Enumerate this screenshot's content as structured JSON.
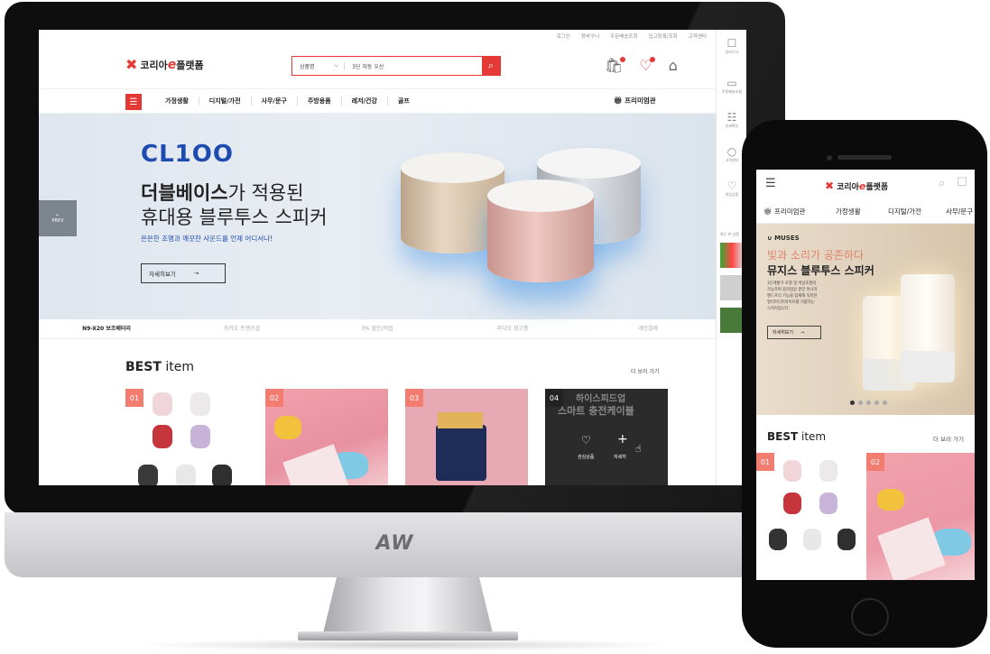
{
  "desktop": {
    "util_links": [
      "로그인",
      "장바구니",
      "주문배송조회",
      "입고등록/조회",
      "고객센터"
    ],
    "logo": {
      "prefix": "코리아",
      "mark": "e",
      "suffix": "플랫폼"
    },
    "search": {
      "category": "상품명",
      "query": "3단 자동 우산"
    },
    "nav_items": [
      "가정생활",
      "디지털/가전",
      "사무/문구",
      "주방용품",
      "레저/건강",
      "골프"
    ],
    "premium": "프리미엄관",
    "hero": {
      "brand": "CL1OO",
      "title_bold": "더블베이스",
      "title_rest": "가 적용된",
      "title_line2": "휴대용 블루투스 스피커",
      "subtitle": "은은한 조명과 깨끗한 사운드를 언제 어디서나!",
      "more_label": "자세히보기",
      "prev_label": "PREV"
    },
    "hero_tabs": [
      "N9-X20 보조배터리",
      "카카오 프렌즈샵",
      "3% 할인/적립",
      "라디오 광고중",
      "개인결제"
    ],
    "best": {
      "title_bold": "BEST",
      "title_rest": " item",
      "more": "더 보러 가기",
      "cards": [
        {
          "num": "01"
        },
        {
          "num": "02"
        },
        {
          "num": "03"
        },
        {
          "num": "04",
          "text1": "하이스피드업",
          "text2": "스마트 충전케이블",
          "actions": [
            "관심상품",
            "자세히"
          ]
        }
      ]
    },
    "side_rail": [
      "장바구니",
      "주문배송조회",
      "인쇄확인",
      "고객센터",
      "관심상품",
      "최근 본 상품"
    ],
    "monitor_logo": "AW"
  },
  "mobile": {
    "logo": {
      "prefix": "코리아",
      "mark": "e",
      "suffix": "플랫폼"
    },
    "cats": [
      "프리미엄관",
      "가정생활",
      "디지털/가전",
      "사무/문구"
    ],
    "hero": {
      "brand": "MUSES",
      "title1": "빛과 소리가 공존하다",
      "title2": "뮤지스 블루투스 스피커",
      "desc": [
        "3단계밝기 조절 및 색상조절이",
        "가능하며 음악감상 분만 아니라",
        "핸드프리 기능을 탑재해 독특한",
        "멀티미디어라이프를 지향하는",
        "스피커입니다."
      ],
      "more_label": "자세히보기"
    },
    "best": {
      "title_bold": "BEST",
      "title_rest": " item",
      "more": "더 보러 가기",
      "cards": [
        {
          "num": "01"
        },
        {
          "num": "02"
        }
      ]
    }
  }
}
